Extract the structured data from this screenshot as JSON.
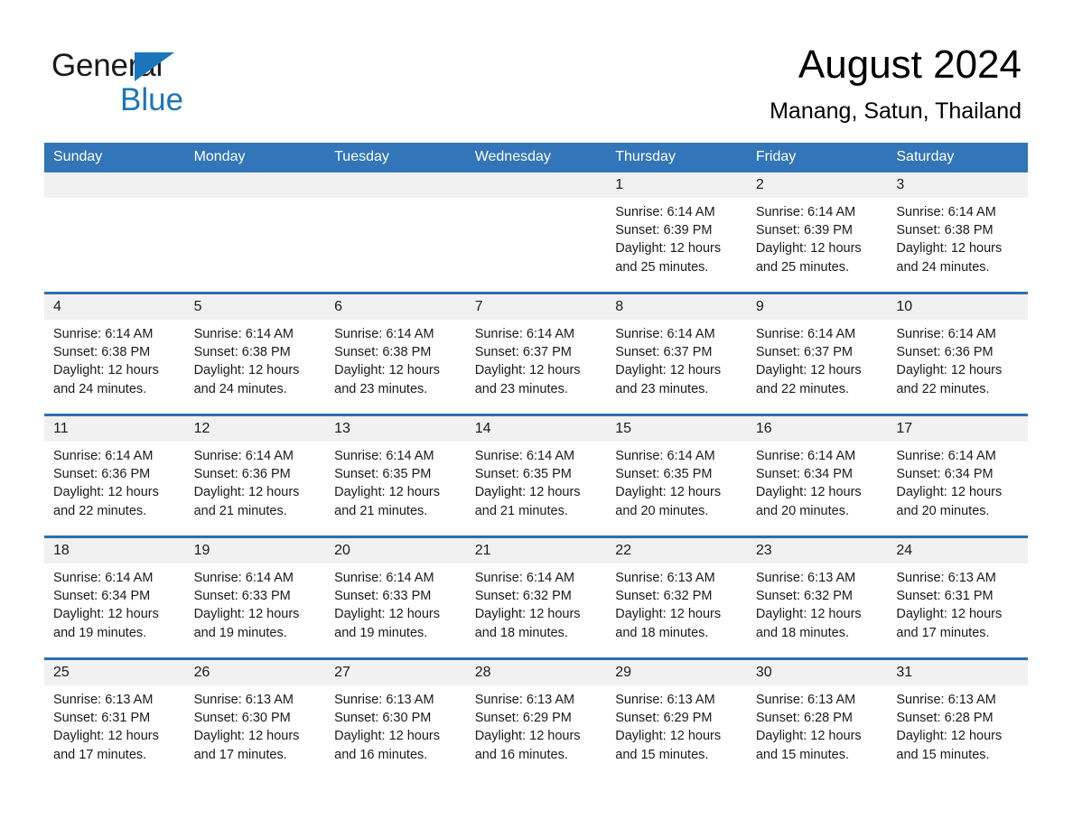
{
  "brand": {
    "name_part1": "General",
    "name_part2": "Blue",
    "accent_color": "#1b75bb",
    "triangle_icon": "triangle-icon"
  },
  "header": {
    "month_title": "August 2024",
    "location": "Manang, Satun, Thailand"
  },
  "calendar": {
    "header_bg": "#3275b8",
    "separator_color": "#2f6eb0",
    "daynum_bg": "#f1f1f1",
    "weekday_headers": [
      "Sunday",
      "Monday",
      "Tuesday",
      "Wednesday",
      "Thursday",
      "Friday",
      "Saturday"
    ],
    "weeks": [
      [
        {
          "day": "",
          "blank": true
        },
        {
          "day": "",
          "blank": true
        },
        {
          "day": "",
          "blank": true
        },
        {
          "day": "",
          "blank": true
        },
        {
          "day": "1",
          "sunrise": "Sunrise: 6:14 AM",
          "sunset": "Sunset: 6:39 PM",
          "daylight": "Daylight: 12 hours and 25 minutes."
        },
        {
          "day": "2",
          "sunrise": "Sunrise: 6:14 AM",
          "sunset": "Sunset: 6:39 PM",
          "daylight": "Daylight: 12 hours and 25 minutes."
        },
        {
          "day": "3",
          "sunrise": "Sunrise: 6:14 AM",
          "sunset": "Sunset: 6:38 PM",
          "daylight": "Daylight: 12 hours and 24 minutes."
        }
      ],
      [
        {
          "day": "4",
          "sunrise": "Sunrise: 6:14 AM",
          "sunset": "Sunset: 6:38 PM",
          "daylight": "Daylight: 12 hours and 24 minutes."
        },
        {
          "day": "5",
          "sunrise": "Sunrise: 6:14 AM",
          "sunset": "Sunset: 6:38 PM",
          "daylight": "Daylight: 12 hours and 24 minutes."
        },
        {
          "day": "6",
          "sunrise": "Sunrise: 6:14 AM",
          "sunset": "Sunset: 6:38 PM",
          "daylight": "Daylight: 12 hours and 23 minutes."
        },
        {
          "day": "7",
          "sunrise": "Sunrise: 6:14 AM",
          "sunset": "Sunset: 6:37 PM",
          "daylight": "Daylight: 12 hours and 23 minutes."
        },
        {
          "day": "8",
          "sunrise": "Sunrise: 6:14 AM",
          "sunset": "Sunset: 6:37 PM",
          "daylight": "Daylight: 12 hours and 23 minutes."
        },
        {
          "day": "9",
          "sunrise": "Sunrise: 6:14 AM",
          "sunset": "Sunset: 6:37 PM",
          "daylight": "Daylight: 12 hours and 22 minutes."
        },
        {
          "day": "10",
          "sunrise": "Sunrise: 6:14 AM",
          "sunset": "Sunset: 6:36 PM",
          "daylight": "Daylight: 12 hours and 22 minutes."
        }
      ],
      [
        {
          "day": "11",
          "sunrise": "Sunrise: 6:14 AM",
          "sunset": "Sunset: 6:36 PM",
          "daylight": "Daylight: 12 hours and 22 minutes."
        },
        {
          "day": "12",
          "sunrise": "Sunrise: 6:14 AM",
          "sunset": "Sunset: 6:36 PM",
          "daylight": "Daylight: 12 hours and 21 minutes."
        },
        {
          "day": "13",
          "sunrise": "Sunrise: 6:14 AM",
          "sunset": "Sunset: 6:35 PM",
          "daylight": "Daylight: 12 hours and 21 minutes."
        },
        {
          "day": "14",
          "sunrise": "Sunrise: 6:14 AM",
          "sunset": "Sunset: 6:35 PM",
          "daylight": "Daylight: 12 hours and 21 minutes."
        },
        {
          "day": "15",
          "sunrise": "Sunrise: 6:14 AM",
          "sunset": "Sunset: 6:35 PM",
          "daylight": "Daylight: 12 hours and 20 minutes."
        },
        {
          "day": "16",
          "sunrise": "Sunrise: 6:14 AM",
          "sunset": "Sunset: 6:34 PM",
          "daylight": "Daylight: 12 hours and 20 minutes."
        },
        {
          "day": "17",
          "sunrise": "Sunrise: 6:14 AM",
          "sunset": "Sunset: 6:34 PM",
          "daylight": "Daylight: 12 hours and 20 minutes."
        }
      ],
      [
        {
          "day": "18",
          "sunrise": "Sunrise: 6:14 AM",
          "sunset": "Sunset: 6:34 PM",
          "daylight": "Daylight: 12 hours and 19 minutes."
        },
        {
          "day": "19",
          "sunrise": "Sunrise: 6:14 AM",
          "sunset": "Sunset: 6:33 PM",
          "daylight": "Daylight: 12 hours and 19 minutes."
        },
        {
          "day": "20",
          "sunrise": "Sunrise: 6:14 AM",
          "sunset": "Sunset: 6:33 PM",
          "daylight": "Daylight: 12 hours and 19 minutes."
        },
        {
          "day": "21",
          "sunrise": "Sunrise: 6:14 AM",
          "sunset": "Sunset: 6:32 PM",
          "daylight": "Daylight: 12 hours and 18 minutes."
        },
        {
          "day": "22",
          "sunrise": "Sunrise: 6:13 AM",
          "sunset": "Sunset: 6:32 PM",
          "daylight": "Daylight: 12 hours and 18 minutes."
        },
        {
          "day": "23",
          "sunrise": "Sunrise: 6:13 AM",
          "sunset": "Sunset: 6:32 PM",
          "daylight": "Daylight: 12 hours and 18 minutes."
        },
        {
          "day": "24",
          "sunrise": "Sunrise: 6:13 AM",
          "sunset": "Sunset: 6:31 PM",
          "daylight": "Daylight: 12 hours and 17 minutes."
        }
      ],
      [
        {
          "day": "25",
          "sunrise": "Sunrise: 6:13 AM",
          "sunset": "Sunset: 6:31 PM",
          "daylight": "Daylight: 12 hours and 17 minutes."
        },
        {
          "day": "26",
          "sunrise": "Sunrise: 6:13 AM",
          "sunset": "Sunset: 6:30 PM",
          "daylight": "Daylight: 12 hours and 17 minutes."
        },
        {
          "day": "27",
          "sunrise": "Sunrise: 6:13 AM",
          "sunset": "Sunset: 6:30 PM",
          "daylight": "Daylight: 12 hours and 16 minutes."
        },
        {
          "day": "28",
          "sunrise": "Sunrise: 6:13 AM",
          "sunset": "Sunset: 6:29 PM",
          "daylight": "Daylight: 12 hours and 16 minutes."
        },
        {
          "day": "29",
          "sunrise": "Sunrise: 6:13 AM",
          "sunset": "Sunset: 6:29 PM",
          "daylight": "Daylight: 12 hours and 15 minutes."
        },
        {
          "day": "30",
          "sunrise": "Sunrise: 6:13 AM",
          "sunset": "Sunset: 6:28 PM",
          "daylight": "Daylight: 12 hours and 15 minutes."
        },
        {
          "day": "31",
          "sunrise": "Sunrise: 6:13 AM",
          "sunset": "Sunset: 6:28 PM",
          "daylight": "Daylight: 12 hours and 15 minutes."
        }
      ]
    ]
  }
}
